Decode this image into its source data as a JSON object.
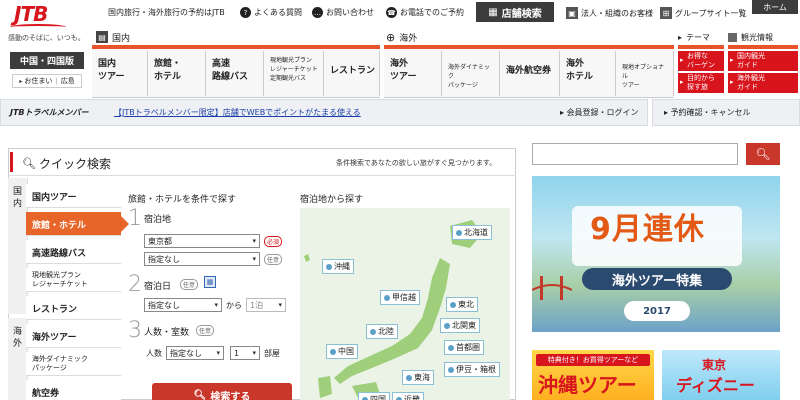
{
  "header": {
    "logo": "JTB",
    "tagline": "感動のそばに、いつも。",
    "links": {
      "tagline_left": "国内旅行・海外旅行の予約はJTB",
      "faq": "よくある質問",
      "contact": "お問い合わせ",
      "phone": "お電話でのご予約",
      "store": "店舗検索",
      "corporate": "法人・組織のお客様",
      "group": "グループサイト一覧",
      "home": "ホーム"
    }
  },
  "region": {
    "current": "中国・四国版",
    "sub_left": "お住まい",
    "sub_right": "広島"
  },
  "nav": {
    "domestic_label": "国内",
    "overseas_label": "海外",
    "theme_label": "テーマ",
    "local_label": "観光情報",
    "domestic": [
      {
        "l1": "国内",
        "l2": "ツアー"
      },
      {
        "l1": "旅館・",
        "l2": "ホテル"
      },
      {
        "l1": "高速",
        "l2": "路線バス"
      },
      {
        "l1": "現地観光プラン",
        "l2": "レジャーチケット",
        "l3": "定期観光バス"
      },
      {
        "l1": "レストラン",
        "l2": ""
      }
    ],
    "overseas": [
      {
        "l1": "海外",
        "l2": "ツアー"
      },
      {
        "l1": "海外ダイナミック",
        "l2": "パッケージ"
      },
      {
        "l1": "海外航空券",
        "l2": ""
      },
      {
        "l1": "海外",
        "l2": "ホテル"
      },
      {
        "l1": "現地オプショナル",
        "l2": "ツアー"
      }
    ],
    "theme": [
      {
        "l1": "お得な",
        "l2": "バーゲン"
      },
      {
        "l1": "目的から",
        "l2": "探す旅"
      }
    ],
    "local": [
      {
        "l1": "国内観光",
        "l2": "ガイド"
      },
      {
        "l1": "海外観光",
        "l2": "ガイド"
      }
    ]
  },
  "member": {
    "logo": "JTBトラベルメンバー",
    "promo": "【JTBトラベルメンバー限定】店舗でWEBでポイントがたまる使える",
    "login": "会員登録・ログイン",
    "reservation": "予約確認・キャンセル"
  },
  "quick": {
    "title": "クイック検索",
    "note": "条件検索であなたの欲しい旅がすぐ見つかります。",
    "side_domestic": [
      "国",
      "内"
    ],
    "side_overseas": [
      "海",
      "外"
    ],
    "tabs": [
      {
        "label": "国内ツアー"
      },
      {
        "label": "旅館・ホテル"
      },
      {
        "label": "高速路線バス"
      },
      {
        "label": "現地観光プラン",
        "label2": "レジャーチケット"
      },
      {
        "label": "レストラン"
      },
      {
        "label": "海外ツアー"
      },
      {
        "label": "海外ダイナミック",
        "label2": "パッケージ"
      },
      {
        "label": "航空券"
      }
    ],
    "form_title": "旅館・ホテルを条件で探す",
    "step1": {
      "num": "1",
      "label": "宿泊地",
      "pref": "東京都",
      "area": "指定なし",
      "required": "必須",
      "optional": "任意"
    },
    "step2": {
      "num": "2",
      "label": "宿泊日",
      "optional": "任意",
      "date": "指定なし",
      "kara": "から",
      "nights": "1泊"
    },
    "step3": {
      "num": "3",
      "label": "人数・室数",
      "optional": "任意",
      "people_label": "人数",
      "people": "指定なし",
      "rooms": "1",
      "rooms_suffix": "部屋"
    },
    "search_button": "検索する",
    "map_title": "宿泊地から探す",
    "map_labels": [
      "北海道",
      "沖縄",
      "甲信越",
      "東北",
      "北陸",
      "北関東",
      "首都圏",
      "中国",
      "伊豆・箱根",
      "東海",
      "四国",
      "近畿"
    ]
  },
  "right": {
    "search_placeholder": "",
    "banner": {
      "big": "9月連休",
      "sub": "海外ツアー特集",
      "year": "2017"
    },
    "promo1": {
      "small": "特典付き！お買得ツアーなど",
      "big": "沖縄ツアー"
    },
    "promo2": {
      "a": "東京",
      "b": "ディズニー"
    }
  }
}
